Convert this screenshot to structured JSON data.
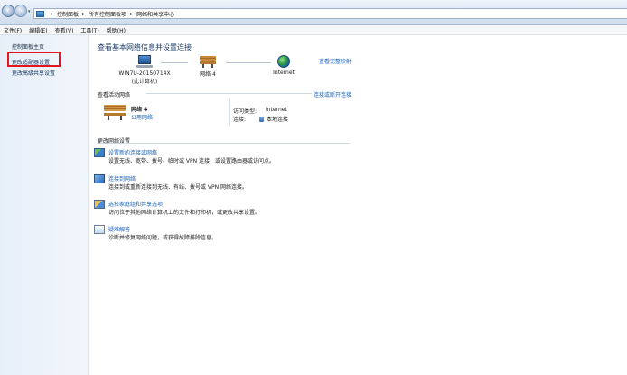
{
  "address_bar": {
    "breadcrumbs": [
      "控制面板",
      "所有控制面板项",
      "网络和共享中心"
    ],
    "separator": "▸",
    "back_icon": "back-arrow-icon",
    "forward_icon": "forward-arrow-icon"
  },
  "menu": [
    "文件(F)",
    "编辑(E)",
    "查看(V)",
    "工具(T)",
    "帮助(H)"
  ],
  "sidebar": {
    "home": "控制面板主页",
    "adapter": "更改适配器设置",
    "sharing": "更改高级共享设置",
    "highlight_color": "#e4171e"
  },
  "main": {
    "title": "查看基本网络信息并设置连接",
    "full_map": "查看完整映射",
    "map": {
      "computer_name": "WIN7U-20150714X",
      "computer_sub": "(此计算机)",
      "network": "网络  4",
      "internet": "Internet"
    },
    "active_title": "查看活动网络",
    "connect_disconnect": "连接或断开连接",
    "active": {
      "name": "网络  4",
      "type": "公用网络",
      "access_label": "访问类型:",
      "access_value": "Internet",
      "conn_label": "连接:",
      "conn_value": "本地连接"
    },
    "change_title": "更改网络设置",
    "tasks": [
      {
        "link": "设置新的连接或网络",
        "desc": "设置无线、宽带、拨号、临时或 VPN 连接；或设置路由器或访问点。",
        "icon": "new-connection-icon"
      },
      {
        "link": "连接到网络",
        "desc": "连接到或重新连接到无线、有线、拨号或 VPN 网络连接。",
        "icon": "connect-network-icon"
      },
      {
        "link": "选择家庭组和共享选项",
        "desc": "访问位于其他网络计算机上的文件和打印机，或更改共享设置。",
        "icon": "homegroup-icon"
      },
      {
        "link": "疑难解答",
        "desc": "诊断并修复网络问题，或获得故障排除信息。",
        "icon": "troubleshoot-icon"
      }
    ]
  }
}
